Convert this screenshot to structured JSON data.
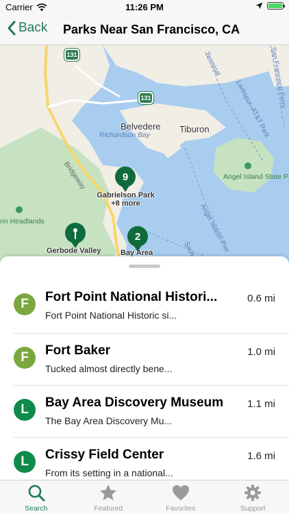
{
  "status_bar": {
    "carrier": "Carrier",
    "time": "11:26 PM"
  },
  "nav": {
    "back_label": "Back",
    "title": "Parks Near San Francisco, CA"
  },
  "map": {
    "labels": {
      "belvedere": "Belvedere",
      "tiburon": "Tiburon",
      "richardson_bay": "Richardson Bay",
      "angel_island": "Angel Island State Park",
      "bridgeway": "Bridgeway",
      "marin_headlands": "rin Headlands",
      "gabrielson_park": "Gabrielson Park",
      "gabrielson_more": "+8 more",
      "gerbode_valley": "Gerbode Valley",
      "bay_area": "Bay Area",
      "route_131_a": "131",
      "route_131_b": "131",
      "terminal": "Terminal",
      "larkspur_ferry": "Larkspur–AT&T Park",
      "sf_ferry": "San Francisco Ferry",
      "angel_island_pier": "Angel Island–Pier",
      "sausalito": "Sausali"
    },
    "clusters": {
      "north_count": "9",
      "south_count": "2"
    }
  },
  "parks": [
    {
      "badge": "F",
      "badge_color": "#7aa83f",
      "name": "Fort Point National Histori...",
      "description": "Fort Point National Historic si...",
      "distance": "0.6 mi"
    },
    {
      "badge": "F",
      "badge_color": "#7aa83f",
      "name": "Fort Baker",
      "description": "Tucked almost directly bene...",
      "distance": "1.0 mi"
    },
    {
      "badge": "L",
      "badge_color": "#0f8a4a",
      "name": "Bay Area Discovery Museum",
      "description": "The Bay Area Discovery Mu...",
      "distance": "1.1 mi"
    },
    {
      "badge": "L",
      "badge_color": "#0f8a4a",
      "name": "Crissy Field Center",
      "description": "From its setting in a national...",
      "distance": "1.6 mi"
    }
  ],
  "tabs": [
    {
      "label": "Search",
      "icon": "search-icon",
      "active": true
    },
    {
      "label": "Featured",
      "icon": "star-icon",
      "active": false
    },
    {
      "label": "Favorites",
      "icon": "heart-icon",
      "active": false
    },
    {
      "label": "Support",
      "icon": "gear-icon",
      "active": false
    }
  ],
  "colors": {
    "accent": "#1f7a5a",
    "pin": "#0f6b3c",
    "water": "#a9cdee",
    "land": "#f1eee6",
    "park_green": "#c6e2c0"
  }
}
